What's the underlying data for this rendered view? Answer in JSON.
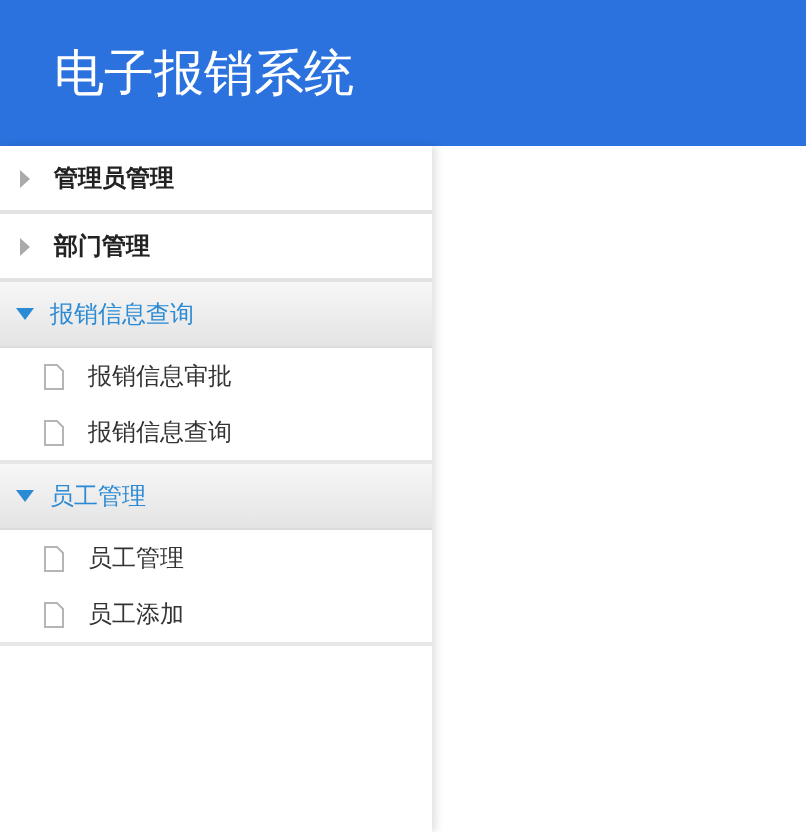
{
  "header": {
    "title": "电子报销系统"
  },
  "menu": [
    {
      "label": "管理员管理",
      "expanded": false
    },
    {
      "label": "部门管理",
      "expanded": false
    },
    {
      "label": "报销信息查询",
      "expanded": true,
      "children": [
        {
          "label": "报销信息审批"
        },
        {
          "label": "报销信息查询"
        }
      ]
    },
    {
      "label": "员工管理",
      "expanded": true,
      "children": [
        {
          "label": "员工管理"
        },
        {
          "label": "员工添加"
        }
      ]
    }
  ]
}
